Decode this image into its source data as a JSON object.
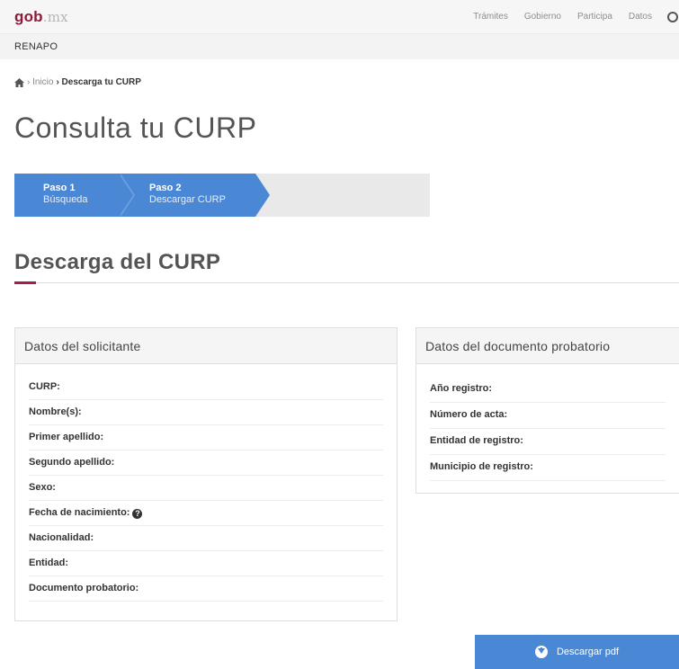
{
  "header": {
    "logo_main": "gob",
    "logo_suffix": ".mx",
    "nav": [
      "Trámites",
      "Gobierno",
      "Participa",
      "Datos"
    ],
    "search_icon": "search-icon"
  },
  "subheader": {
    "label": "RENAPO"
  },
  "breadcrumb": {
    "home_icon": "home-icon",
    "items": [
      "› Inicio",
      "› Descarga tu CURP"
    ]
  },
  "page_title": "Consulta tu CURP",
  "steps": [
    {
      "title": "Paso 1",
      "subtitle": "Búsqueda"
    },
    {
      "title": "Paso 2",
      "subtitle": "Descargar CURP"
    }
  ],
  "section_title": "Descarga del CURP",
  "solicitante": {
    "title": "Datos del solicitante",
    "fields": [
      "CURP:",
      "Nombre(s):",
      "Primer apellido:",
      "Segundo apellido:",
      "Sexo:",
      "Fecha de nacimiento:",
      "Nacionalidad:",
      "Entidad:",
      "Documento probatorio:"
    ],
    "help_icon": "question-circle-icon"
  },
  "documento": {
    "title": "Datos del documento probatorio",
    "fields": [
      "Año registro:",
      "Número de acta:",
      "Entidad de registro:",
      "Municipio de registro:"
    ]
  },
  "download_button": {
    "label": "Descargar pdf",
    "icon": "download-circle-icon"
  },
  "colors": {
    "brand": "#8c1b3a",
    "primary": "#4a88d6",
    "accent": "#a31f49"
  }
}
